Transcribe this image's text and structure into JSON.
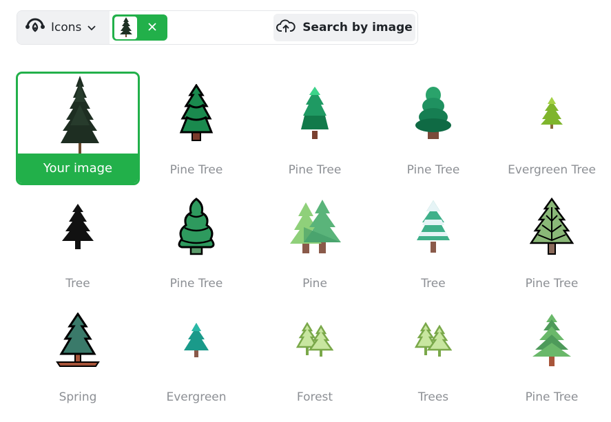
{
  "search": {
    "type_label": "Icons",
    "search_by_image_label": "Search by image",
    "accent_color": "#22b04a"
  },
  "results": {
    "your_image_label": "Your image",
    "items": [
      {
        "label": "Pine Tree",
        "icon": "pine-tree-black-outline-icon"
      },
      {
        "label": "Pine Tree",
        "icon": "pine-tree-gradient-icon"
      },
      {
        "label": "Pine Tree",
        "icon": "pine-tree-flat-green-icon"
      },
      {
        "label": "Evergreen Tree",
        "icon": "evergreen-tree-small-icon"
      },
      {
        "label": "Tree",
        "icon": "tree-silhouette-icon"
      },
      {
        "label": "Pine Tree",
        "icon": "pine-tree-lineal-color-icon"
      },
      {
        "label": "Pine",
        "icon": "pine-pair-icon"
      },
      {
        "label": "Tree",
        "icon": "snowy-tree-icon"
      },
      {
        "label": "Pine Tree",
        "icon": "pine-tree-sketch-icon"
      },
      {
        "label": "Spring",
        "icon": "spring-tree-icon"
      },
      {
        "label": "Evergreen",
        "icon": "evergreen-teal-icon"
      },
      {
        "label": "Forest",
        "icon": "forest-outline-icon"
      },
      {
        "label": "Trees",
        "icon": "trees-outline-icon"
      },
      {
        "label": "Pine Tree",
        "icon": "pine-tree-layered-icon"
      }
    ]
  }
}
